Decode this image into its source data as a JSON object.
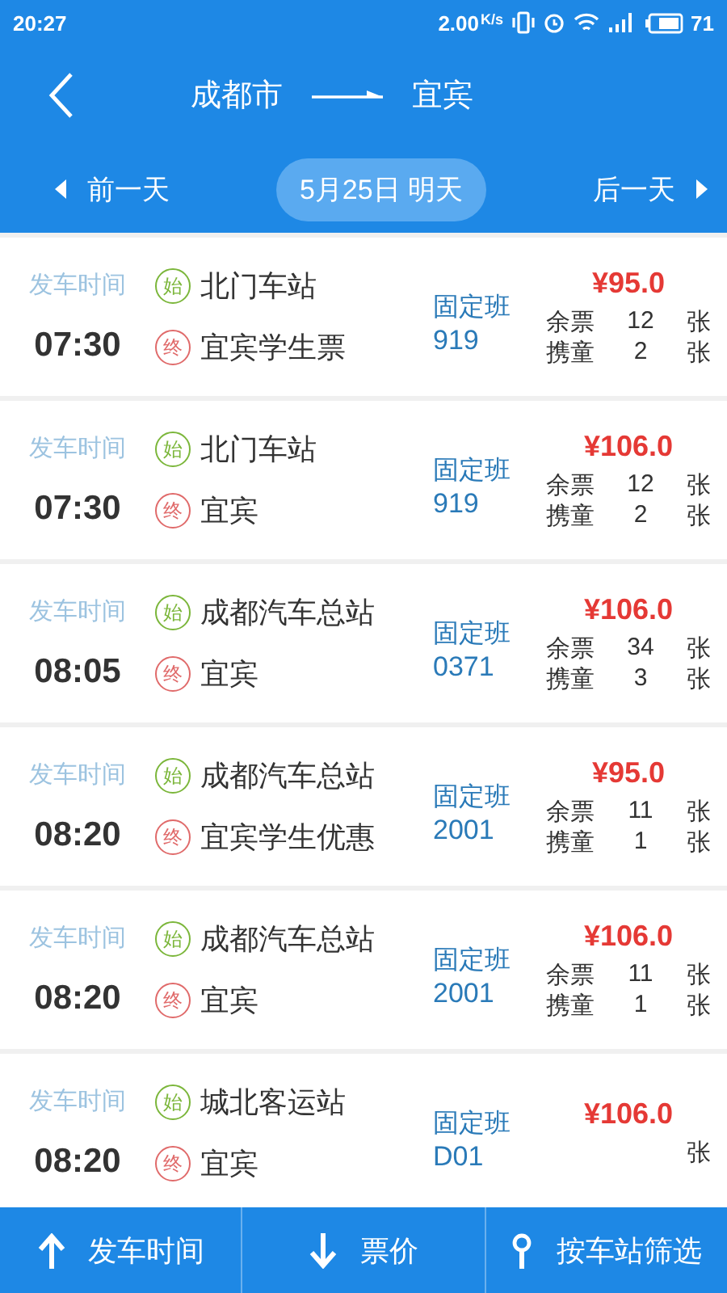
{
  "status_bar": {
    "time": "20:27",
    "speed": "2.00",
    "speed_unit": "K/s",
    "battery": "71"
  },
  "header": {
    "from": "成都市",
    "to": "宜宾"
  },
  "date_nav": {
    "prev": "前一天",
    "current": "5月25日 明天",
    "next": "后一天"
  },
  "trips": [
    {
      "time_label": "发车时间",
      "time": "07:30",
      "start_badge": "始",
      "start": "北门车站",
      "end_badge": "终",
      "end": "宜宾学生票",
      "kind_label": "固定班",
      "number": "919",
      "price": "¥95.0",
      "remain_label": "余票",
      "remain": "12",
      "remain_unit": "张",
      "child_label": "携童",
      "child": "2",
      "child_unit": "张"
    },
    {
      "time_label": "发车时间",
      "time": "07:30",
      "start_badge": "始",
      "start": "北门车站",
      "end_badge": "终",
      "end": "宜宾",
      "kind_label": "固定班",
      "number": "919",
      "price": "¥106.0",
      "remain_label": "余票",
      "remain": "12",
      "remain_unit": "张",
      "child_label": "携童",
      "child": "2",
      "child_unit": "张"
    },
    {
      "time_label": "发车时间",
      "time": "08:05",
      "start_badge": "始",
      "start": "成都汽车总站",
      "end_badge": "终",
      "end": "宜宾",
      "kind_label": "固定班",
      "number": "0371",
      "price": "¥106.0",
      "remain_label": "余票",
      "remain": "34",
      "remain_unit": "张",
      "child_label": "携童",
      "child": "3",
      "child_unit": "张"
    },
    {
      "time_label": "发车时间",
      "time": "08:20",
      "start_badge": "始",
      "start": "成都汽车总站",
      "end_badge": "终",
      "end": "宜宾学生优惠",
      "kind_label": "固定班",
      "number": "2001",
      "price": "¥95.0",
      "remain_label": "余票",
      "remain": "11",
      "remain_unit": "张",
      "child_label": "携童",
      "child": "1",
      "child_unit": "张"
    },
    {
      "time_label": "发车时间",
      "time": "08:20",
      "start_badge": "始",
      "start": "成都汽车总站",
      "end_badge": "终",
      "end": "宜宾",
      "kind_label": "固定班",
      "number": "2001",
      "price": "¥106.0",
      "remain_label": "余票",
      "remain": "11",
      "remain_unit": "张",
      "child_label": "携童",
      "child": "1",
      "child_unit": "张"
    },
    {
      "time_label": "发车时间",
      "time": "08:20",
      "start_badge": "始",
      "start": "城北客运站",
      "end_badge": "终",
      "end": "宜宾",
      "kind_label": "固定班",
      "number": "D01",
      "price": "¥106.0",
      "remain_unit": "张"
    }
  ],
  "bottom_bar": [
    {
      "kind": "up",
      "label": "发车时间"
    },
    {
      "kind": "down",
      "label": "票价"
    },
    {
      "kind": "filter",
      "label": "按车站筛选"
    }
  ]
}
